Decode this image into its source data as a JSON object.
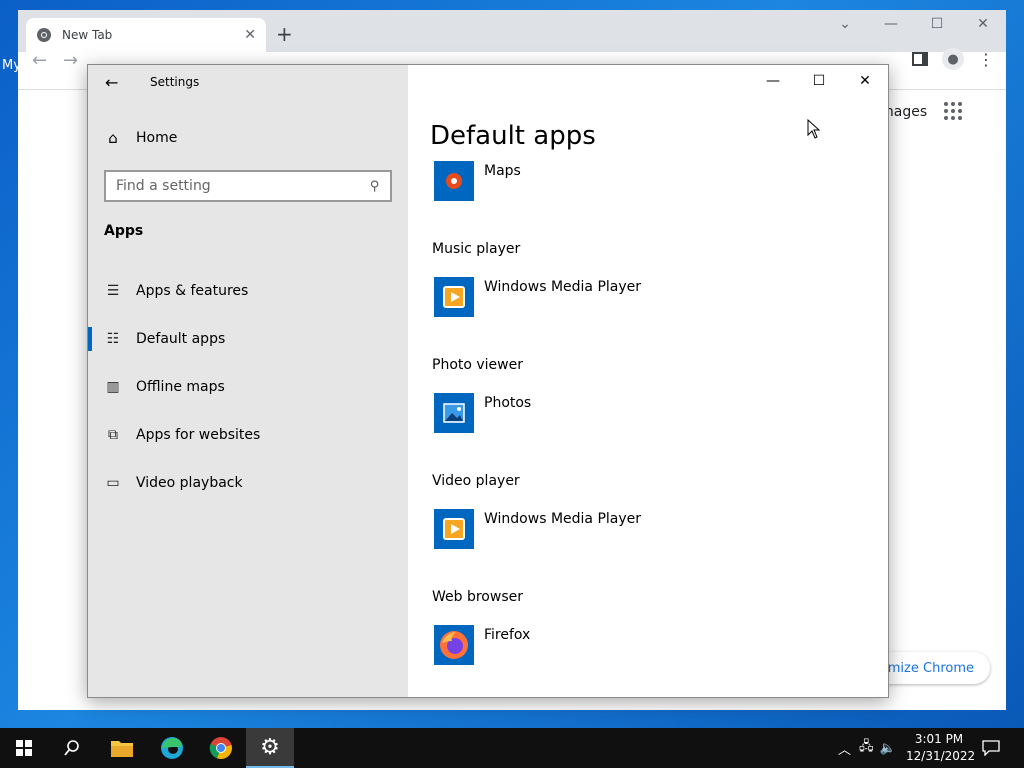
{
  "desktop": {
    "label": "My"
  },
  "chrome": {
    "tab_title": "New Tab",
    "new_tab": "+",
    "images_link": "Images",
    "customize_label": "tomize Chrome"
  },
  "settings": {
    "title": "Settings",
    "home_label": "Home",
    "search_placeholder": "Find a setting",
    "section_heading": "Apps",
    "nav_items": [
      {
        "label": "Apps & features",
        "icon": "list-icon"
      },
      {
        "label": "Default apps",
        "icon": "default-list-icon",
        "selected": true
      },
      {
        "label": "Offline maps",
        "icon": "map-icon"
      },
      {
        "label": "Apps for websites",
        "icon": "open-in-icon"
      },
      {
        "label": "Video playback",
        "icon": "video-camera-icon"
      }
    ],
    "page_title": "Default apps",
    "categories": [
      {
        "label": "",
        "app": "Maps",
        "icon": "maps-pin-icon"
      },
      {
        "label": "Music player",
        "app": "Windows Media Player",
        "icon": "media-player-icon"
      },
      {
        "label": "Photo viewer",
        "app": "Photos",
        "icon": "photos-icon"
      },
      {
        "label": "Video player",
        "app": "Windows Media Player",
        "icon": "media-player-icon"
      },
      {
        "label": "Web browser",
        "app": "Firefox",
        "icon": "firefox-icon"
      }
    ]
  },
  "taskbar": {
    "time": "3:01 PM",
    "date": "12/31/2022"
  },
  "colors": {
    "accent": "#0067c0",
    "sidebar_bg": "#e6e6e6",
    "taskbar_bg": "#101010"
  }
}
